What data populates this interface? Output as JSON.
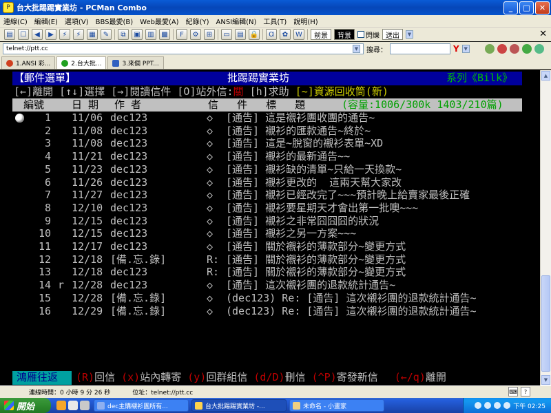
{
  "window": {
    "title": "台大批踢踢實業坊 - PCMan Combo",
    "minimize": "_",
    "maximize": "□",
    "close": "✕"
  },
  "menu": [
    "連線(C)",
    "編輯(E)",
    "選項(V)",
    "BBS最愛(B)",
    "Web最愛(A)",
    "紀錄(Y)",
    "ANSI編輯(N)",
    "工具(T)",
    "說明(H)"
  ],
  "toolbar": {
    "prev_label": "前景",
    "bg_label": "背景",
    "flash_label": "閃爍",
    "send_label": "送出"
  },
  "address": {
    "value": "telnet://ptt.cc",
    "search_label": "搜尋："
  },
  "tabs": [
    {
      "label": "1.ANSI 彩...",
      "color": "#d04020"
    },
    {
      "label": "2.台大批...",
      "color": "#20a020"
    },
    {
      "label": "3.來個 PPT...",
      "color": "#3060c0"
    }
  ],
  "terminal": {
    "header_left": "【郵件選單】",
    "header_mid": "批踢踢實業坊",
    "header_right": "系列《Bilk》",
    "help_a": "[←]離開 [↑↓]選擇 [→]閱讀信件 [O]站外信:",
    "help_b": "關",
    "help_c": " [h]求助 ",
    "help_d": "[~]資源回收筒(新)",
    "col_no": "編號",
    "col_date": "日 期",
    "col_author": "作 者",
    "col_title": "信   件   標   題",
    "capacity": "(容量:1006/300k 1403/210篇)",
    "mails": [
      {
        "no": "1",
        "flag": "",
        "date": "11/06",
        "author": "dec123",
        "mark": "◇",
        "subject": "[通告] 這是襯衫團收團的通告~"
      },
      {
        "no": "2",
        "flag": "",
        "date": "11/08",
        "author": "dec123",
        "mark": "◇",
        "subject": "[通告] 襯衫的匯款通告~終於~"
      },
      {
        "no": "3",
        "flag": "",
        "date": "11/08",
        "author": "dec123",
        "mark": "◇",
        "subject": "[通告] 這是~脫窗的襯衫表單~XD"
      },
      {
        "no": "4",
        "flag": "",
        "date": "11/21",
        "author": "dec123",
        "mark": "◇",
        "subject": "[通告] 襯衫的最新通告~~"
      },
      {
        "no": "5",
        "flag": "",
        "date": "11/23",
        "author": "dec123",
        "mark": "◇",
        "subject": "[通告] 襯衫缺的清單~只給一天換款~"
      },
      {
        "no": "6",
        "flag": "",
        "date": "11/26",
        "author": "dec123",
        "mark": "◇",
        "subject": "[通告] 襯衫更改的  這兩天幫大家改"
      },
      {
        "no": "7",
        "flag": "",
        "date": "11/27",
        "author": "dec123",
        "mark": "◇",
        "subject": "[通告] 襯衫已經改完了~~~預計晚上給賣家最後正確"
      },
      {
        "no": "8",
        "flag": "",
        "date": "12/10",
        "author": "dec123",
        "mark": "◇",
        "subject": "[通告] 襯衫要星期天才會出第一批噢~~~"
      },
      {
        "no": "9",
        "flag": "",
        "date": "12/15",
        "author": "dec123",
        "mark": "◇",
        "subject": "[通告] 襯衫之非常囧囧囧的狀況"
      },
      {
        "no": "10",
        "flag": "",
        "date": "12/15",
        "author": "dec123",
        "mark": "◇",
        "subject": "[通告] 襯衫之另一方案~~~"
      },
      {
        "no": "11",
        "flag": "",
        "date": "12/17",
        "author": "dec123",
        "mark": "◇",
        "subject": "[通告] 關於襯衫的薄款部分~變更方式"
      },
      {
        "no": "12",
        "flag": "",
        "date": "12/18",
        "author": "[備.忘.錄]",
        "mark": "R:",
        "subject": "[通告] 關於襯衫的薄款部分~變更方式"
      },
      {
        "no": "13",
        "flag": "",
        "date": "12/18",
        "author": "dec123",
        "mark": "R:",
        "subject": "[通告] 關於襯衫的薄款部分~變更方式"
      },
      {
        "no": "14",
        "flag": "r",
        "date": "12/28",
        "author": "dec123",
        "mark": "◇",
        "subject": "[通告] 這次襯衫團的退款統計通告~"
      },
      {
        "no": "15",
        "flag": "",
        "date": "12/28",
        "author": "[備.忘.錄]",
        "mark": "◇",
        "subject": "(dec123) Re: [通告] 這次襯衫團的退款統計通告~"
      },
      {
        "no": "16",
        "flag": "",
        "date": "12/29",
        "author": "[備.忘.錄]",
        "mark": "◇",
        "subject": "(dec123) Re: [通告] 這次襯衫團的退款統計通告~"
      }
    ],
    "footer_cyan": "鴻雁往返",
    "footer_r": "(R)",
    "footer_r_t": "回信 ",
    "footer_x": "(x)",
    "footer_x_t": "站內轉寄 ",
    "footer_y": "(y)",
    "footer_y_t": "回群組信 ",
    "footer_d": "(d/D)",
    "footer_d_t": "刪信 ",
    "footer_p": "(^P)",
    "footer_p_t": "寄發新信",
    "footer_q": "(←/q)",
    "footer_q_t": "離開"
  },
  "status": {
    "conn_time": "連線時間：0 小時 9 分 26 秒",
    "location": "位址：telnet://ptt.cc"
  },
  "taskbar": {
    "start": "開始",
    "tasks": [
      "dec主購襯衫團所有...",
      "台大批踢踢實業坊 -...",
      "未命名 - 小畫家"
    ],
    "clock": "下午 02:25"
  }
}
